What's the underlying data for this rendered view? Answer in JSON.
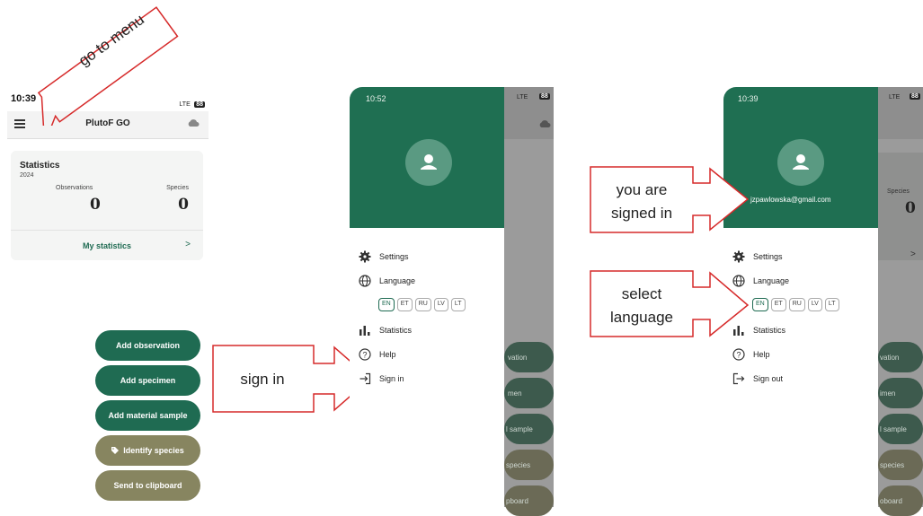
{
  "annotations": {
    "go_to_menu": "go to menu",
    "sign_in": "sign in",
    "signed_in": [
      "you are",
      "signed in"
    ],
    "select_language": [
      "select",
      "language"
    ]
  },
  "phone1": {
    "time": "10:39",
    "signal": "LTE",
    "battery": "88",
    "app_title": "PlutoF GO",
    "stats": {
      "title": "Statistics",
      "year": "2024",
      "observations_label": "Observations",
      "observations_value": "0",
      "species_label": "Species",
      "species_value": "0",
      "link": "My statistics",
      "link_chevron": ">"
    },
    "buttons": [
      "Add observation",
      "Add specimen",
      "Add material sample",
      "Identify species",
      "Send to clipboard"
    ]
  },
  "phone2": {
    "time": "10:52",
    "signal": "LTE",
    "battery": "88",
    "menu": [
      "Settings",
      "Language",
      "Statistics",
      "Help",
      "Sign in"
    ],
    "languages": [
      "EN",
      "ET",
      "RU",
      "LV",
      "LT"
    ],
    "selected_language": "EN",
    "behind": [
      "vation",
      "men",
      "l sample",
      "species",
      "pboard"
    ]
  },
  "phone3": {
    "time": "10:39",
    "signal": "LTE",
    "battery": "88",
    "email": "jzpawlowska@gmail.com",
    "menu": [
      "Settings",
      "Language",
      "Statistics",
      "Help",
      "Sign out"
    ],
    "languages": [
      "EN",
      "ET",
      "RU",
      "LV",
      "LT"
    ],
    "selected_language": "EN",
    "behind_species_label": "Species",
    "behind_species_value": "0",
    "behind_chevron": ">",
    "behind": [
      "vation",
      "imen",
      "l sample",
      "species",
      "oboard"
    ]
  },
  "colors": {
    "accent": "#1f6b52",
    "olive": "#878560",
    "annotation": "#d62a2a"
  },
  "icons": [
    "menu-icon",
    "cloud-icon",
    "person-icon",
    "gear-icon",
    "globe-icon",
    "bar-chart-icon",
    "help-icon",
    "sign-in-icon",
    "sign-out-icon",
    "tag-icon"
  ]
}
